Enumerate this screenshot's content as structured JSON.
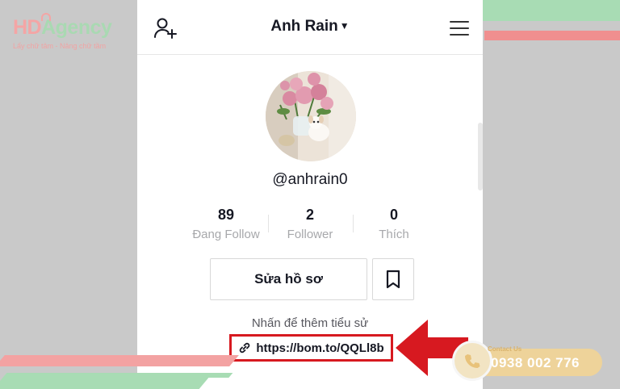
{
  "logo": {
    "brand_hd": "HD",
    "brand_agency": "Agency",
    "tagline": "Lấy chữ tâm - Nâng chữ tầm"
  },
  "profile": {
    "username": "Anh Rain",
    "handle": "@anhrain0",
    "stats": [
      {
        "value": "89",
        "label": "Đang Follow"
      },
      {
        "value": "2",
        "label": "Follower"
      },
      {
        "value": "0",
        "label": "Thích"
      }
    ],
    "edit_label": "Sửa hồ sơ",
    "bio_placeholder": "Nhấn để thêm tiểu sử",
    "link": "https://bom.to/QQLl8b"
  },
  "contact": {
    "label": "Contact Us",
    "phone": "0938 002 776"
  },
  "colors": {
    "highlight_red": "#d71920",
    "brand_pink": "#f4a5a5",
    "brand_green": "#a9d9b2",
    "badge_gold": "#eed39a"
  }
}
